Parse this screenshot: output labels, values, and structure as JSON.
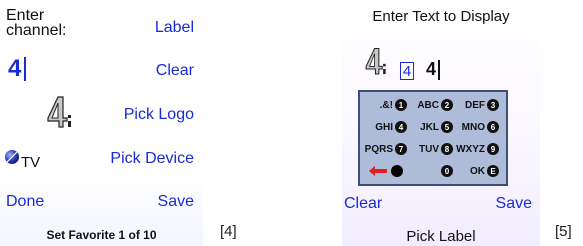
{
  "screen4": {
    "title_line1": "Enter",
    "title_line2": "channel:",
    "channel_value": "4",
    "tv_label": "TV",
    "buttons": {
      "label": "Label",
      "clear": "Clear",
      "pick_logo": "Pick Logo",
      "pick_device": "Pick Device",
      "done": "Done",
      "save": "Save"
    },
    "footer": "Set Favorite 1 of 10",
    "figure_label": "[4]"
  },
  "screen5": {
    "title": "Enter Text to Display",
    "boxed_value": "4",
    "entry_value": "4",
    "keypad": {
      "rows": [
        [
          {
            "letters": ".&!",
            "digit": "1"
          },
          {
            "letters": "ABC",
            "digit": "2"
          },
          {
            "letters": "DEF",
            "digit": "3"
          }
        ],
        [
          {
            "letters": "GHI",
            "digit": "4"
          },
          {
            "letters": "JKL",
            "digit": "5"
          },
          {
            "letters": "MNO",
            "digit": "6"
          }
        ],
        [
          {
            "letters": "PQRS",
            "digit": "7"
          },
          {
            "letters": "TUV",
            "digit": "8"
          },
          {
            "letters": "WXYZ",
            "digit": "9"
          }
        ],
        [
          {
            "letters": "",
            "digit": ""
          },
          {
            "letters": "",
            "digit": "0"
          },
          {
            "letters": "OK",
            "digit": "E"
          }
        ]
      ]
    },
    "buttons": {
      "clear": "Clear",
      "save": "Save"
    },
    "footer": "Pick Label",
    "figure_label": "[5]"
  },
  "colors": {
    "accent_blue": "#1a2bd6",
    "keypad_bg": "#aebbd9",
    "backspace_red": "#e02020"
  }
}
